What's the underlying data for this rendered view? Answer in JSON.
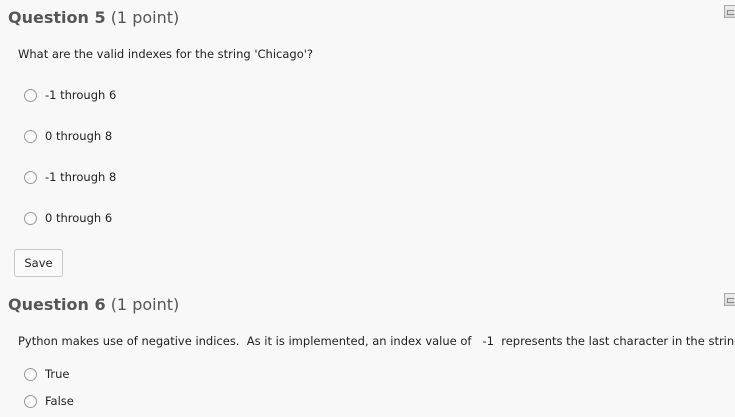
{
  "questions": [
    {
      "number_label": "Question 5",
      "points_label": "(1 point)",
      "prompt": "What are the valid indexes for the string 'Chicago'?",
      "options": [
        "-1 through 6",
        "0 through 8",
        "-1 through 8",
        "0 through 6"
      ],
      "save_label": "Save"
    },
    {
      "number_label": "Question 6",
      "points_label": "(1 point)",
      "prompt": "Python makes use of negative indices.  As it is implemented, an index value of   -1  represents the last character in the string.",
      "options": [
        "True",
        "False"
      ]
    }
  ],
  "icons": {
    "question_icon": "question-options-icon"
  }
}
